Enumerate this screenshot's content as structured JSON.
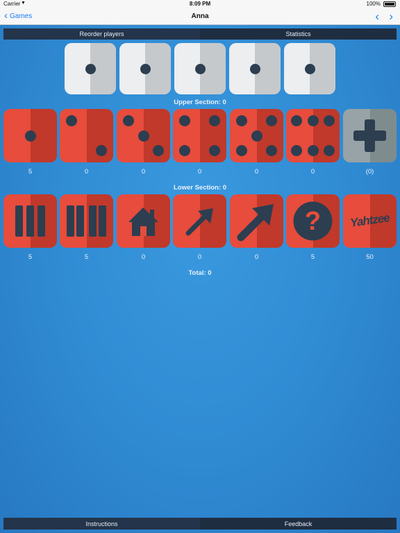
{
  "status_bar": {
    "carrier": "Carrier",
    "time": "8:09 PM",
    "battery": "100%"
  },
  "nav": {
    "back_label": "Games",
    "title": "Anna"
  },
  "segments_top": [
    "Reorder players",
    "Statistics"
  ],
  "segments_bottom": [
    "Instructions",
    "Feedback"
  ],
  "dice": [
    1,
    1,
    1,
    1,
    1
  ],
  "upper_section": {
    "label": "Upper Section: 0",
    "tiles": [
      {
        "name": "ones",
        "icon": "die-one-icon",
        "score": "5"
      },
      {
        "name": "twos",
        "icon": "die-two-icon",
        "score": "0"
      },
      {
        "name": "threes",
        "icon": "die-three-icon",
        "score": "0"
      },
      {
        "name": "fours",
        "icon": "die-four-icon",
        "score": "0"
      },
      {
        "name": "fives",
        "icon": "die-five-icon",
        "score": "0"
      },
      {
        "name": "sixes",
        "icon": "die-six-icon",
        "score": "0"
      },
      {
        "name": "bonus",
        "icon": "plus-icon",
        "score": "(0)"
      }
    ]
  },
  "lower_section": {
    "label": "Lower Section: 0",
    "tiles": [
      {
        "name": "three-of-a-kind",
        "icon": "three-bars-icon",
        "score": "5"
      },
      {
        "name": "four-of-a-kind",
        "icon": "four-bars-icon",
        "score": "5"
      },
      {
        "name": "full-house",
        "icon": "house-icon",
        "score": "0"
      },
      {
        "name": "small-straight",
        "icon": "small-arrow-icon",
        "score": "0"
      },
      {
        "name": "large-straight",
        "icon": "large-arrow-icon",
        "score": "0"
      },
      {
        "name": "chance",
        "icon": "question-mark-icon",
        "score": "5"
      },
      {
        "name": "yahtzee",
        "icon": "yahtzee-logo-icon",
        "text": "Yahtzee",
        "score": "50"
      }
    ]
  },
  "total": "Total: 0",
  "colors": {
    "background": "#2f8ad2",
    "tile_red": "#e74c3c",
    "tile_red_dark": "#c0392b",
    "tile_gray": "#97a3a6",
    "pip": "#2c3e50",
    "segment_bar": "#24344a",
    "ios_blue": "#1a7cf5"
  }
}
